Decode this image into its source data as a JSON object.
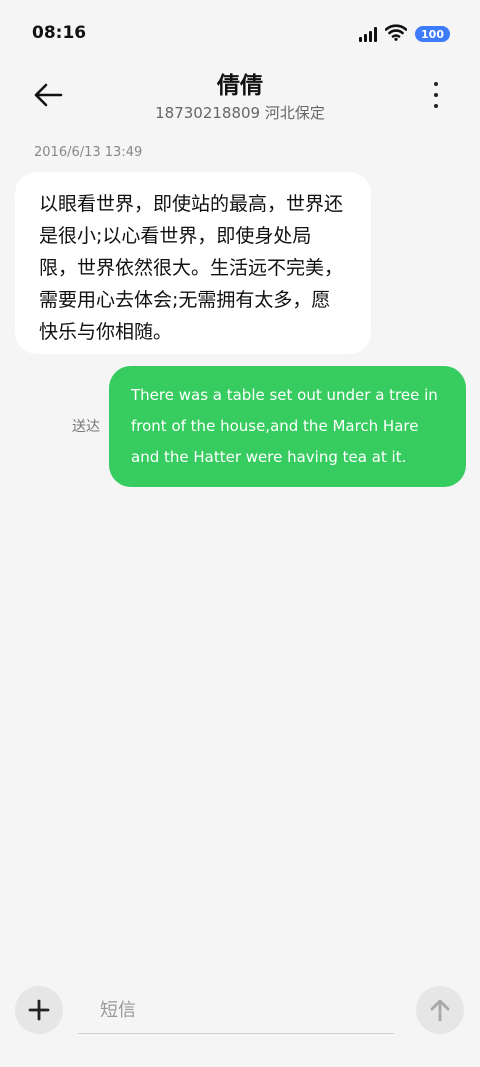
{
  "status_bar": {
    "time": "08:16",
    "battery": "100",
    "icons": [
      "signal-icon",
      "wifi-icon",
      "battery-icon"
    ],
    "battery_color": "#3e7bfa"
  },
  "header": {
    "contact_name": "倩倩",
    "contact_detail": "18730218809 河北保定",
    "icons": [
      "back-arrow-icon",
      "more-vertical-icon"
    ]
  },
  "conversation": {
    "timestamp": "2016/6/13 13:49",
    "received": {
      "text": "以眼看世界，即使站的最高，世界还是很小;以心看世界，即使身处局限，世界依然很大。生活远不完美，需要用心去体会;无需拥有太多，愿快乐与你相随。",
      "bubble_color": "#ffffff"
    },
    "sent": {
      "status": "送达",
      "text": "There was a table set out under a tree in front of the house,and the March Hare and the Hatter were having tea at it.",
      "bubble_color": "#37cc5f"
    }
  },
  "composer": {
    "placeholder": "短信",
    "icons": [
      "add-icon",
      "send-arrow-icon"
    ]
  }
}
